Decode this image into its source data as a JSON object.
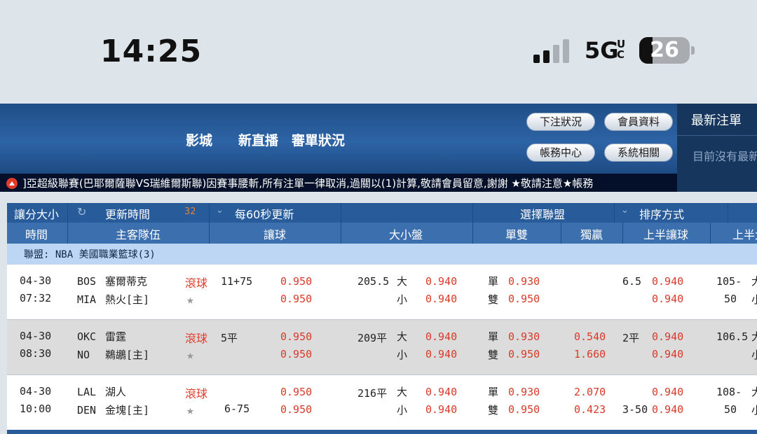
{
  "status_bar": {
    "time": "14:25",
    "network": "5G",
    "network_sub": "UC",
    "battery": "26",
    "battery_level": 0.26
  },
  "header": {
    "nav": [
      "影城",
      "新直播",
      "審單狀況"
    ],
    "buttons": {
      "bet_status": "下注狀況",
      "member_info": "會員資料",
      "account_center": "帳務中心",
      "system": "系統相關"
    },
    "latest_bets_title": "最新注單",
    "latest_bets_empty": "目前沒有最新"
  },
  "marquee": "]亞超級聯賽(巴耶爾薩聯VS瑞維爾斯聯)因賽事腰斬,所有注單一律取消,過關以(1)計算,敬請會員留意,謝謝 ★敬請注意★帳務",
  "toolbar": {
    "odds_type": "讓分大小",
    "refresh_time": "更新時間",
    "countdown": "32",
    "auto_refresh": "每60秒更新",
    "select_league": "選擇聯盟",
    "sort": "排序方式"
  },
  "columns": [
    "時間",
    "主客隊伍",
    "讓球",
    "大小盤",
    "單雙",
    "獨贏",
    "上半讓球",
    "上半大"
  ],
  "league": "聯盟: NBA 美國職業籃球(3)",
  "live_label": "滾球",
  "matches": [
    {
      "date": "04-30",
      "time": "07:32",
      "home_code": "BOS",
      "home_name": "塞爾蒂克",
      "away_code": "MIA",
      "away_name": "熱火[主]",
      "hdp_line_top": "11+75",
      "hdp_line_bottom": "",
      "hdp_odds_top": "0.950",
      "hdp_odds_bottom": "0.950",
      "ou_line": "205.5",
      "ou_over": "大",
      "ou_under": "小",
      "ou_odds_top": "0.940",
      "ou_odds_bottom": "0.940",
      "odd": "單",
      "even": "雙",
      "oe_odd": "0.930",
      "oe_even": "0.950",
      "ml_top": "",
      "ml_bottom": "",
      "h1_line_top": "6.5",
      "h1_line_bottom": "",
      "h1_odds_top": "0.940",
      "h1_odds_bottom": "0.940",
      "h1ou_top": "105-",
      "h1ou_top_suffix": "大",
      "h1ou_bottom": "50",
      "h1ou_bottom_suffix": "小"
    },
    {
      "date": "04-30",
      "time": "08:30",
      "home_code": "OKC",
      "home_name": "雷霆",
      "away_code": "NO",
      "away_name": "鵜鶘[主]",
      "hdp_line_top": "5平",
      "hdp_line_bottom": "",
      "hdp_odds_top": "0.950",
      "hdp_odds_bottom": "0.950",
      "ou_line": "209平",
      "ou_over": "大",
      "ou_under": "小",
      "ou_odds_top": "0.940",
      "ou_odds_bottom": "0.940",
      "odd": "單",
      "even": "雙",
      "oe_odd": "0.930",
      "oe_even": "0.950",
      "ml_top": "0.540",
      "ml_bottom": "1.660",
      "h1_line_top": "2平",
      "h1_line_bottom": "",
      "h1_odds_top": "0.940",
      "h1_odds_bottom": "0.940",
      "h1ou_top": "106.5",
      "h1ou_top_suffix": "大",
      "h1ou_bottom": "",
      "h1ou_bottom_suffix": "小"
    },
    {
      "date": "04-30",
      "time": "10:00",
      "home_code": "LAL",
      "home_name": "湖人",
      "away_code": "DEN",
      "away_name": "金塊[主]",
      "hdp_line_top": "",
      "hdp_line_bottom": "6-75",
      "hdp_odds_top": "0.950",
      "hdp_odds_bottom": "0.950",
      "ou_line": "216平",
      "ou_over": "大",
      "ou_under": "小",
      "ou_odds_top": "0.940",
      "ou_odds_bottom": "0.940",
      "odd": "單",
      "even": "雙",
      "oe_odd": "0.930",
      "oe_even": "0.950",
      "ml_top": "2.070",
      "ml_bottom": "0.423",
      "h1_line_top": "",
      "h1_line_bottom": "3-50",
      "h1_odds_top": "0.940",
      "h1_odds_bottom": "0.940",
      "h1ou_top": "108-",
      "h1ou_top_suffix": "大",
      "h1ou_bottom": "50",
      "h1ou_bottom_suffix": "小"
    }
  ]
}
